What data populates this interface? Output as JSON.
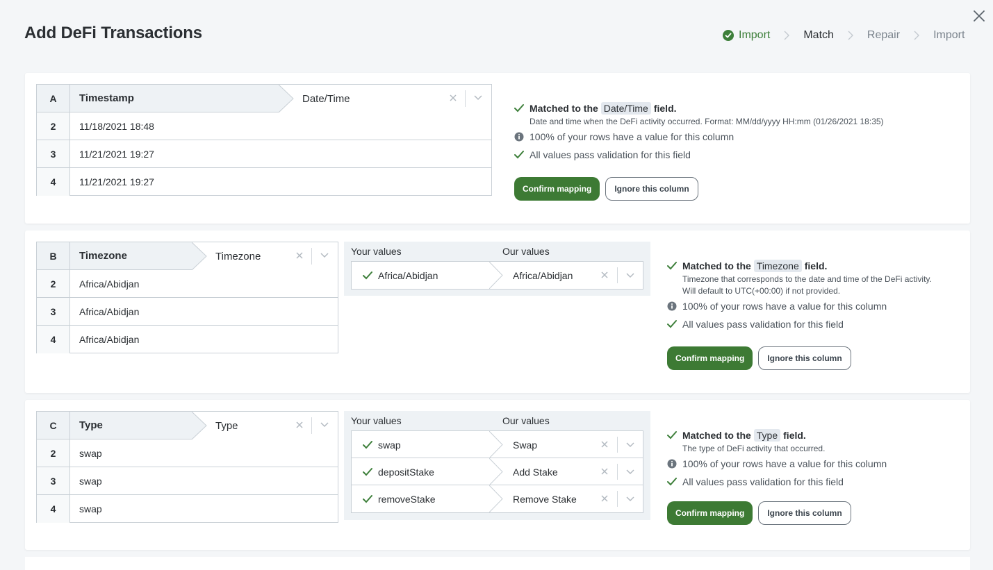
{
  "dialog": {
    "title": "Add DeFi Transactions"
  },
  "stepper": {
    "steps": [
      "Import",
      "Match",
      "Repair",
      "Import"
    ]
  },
  "labels": {
    "your_values": "Your values",
    "our_values": "Our values",
    "matched_prefix": "Matched to the",
    "matched_suffix": "field.",
    "confirm": "Confirm mapping",
    "ignore": "Ignore this column"
  },
  "columns": [
    {
      "letter": "A",
      "name": "Timestamp",
      "field": "Date/Time",
      "rows": [
        {
          "num": "2",
          "value": "11/18/2021 18:48"
        },
        {
          "num": "3",
          "value": "11/21/2021 19:27"
        },
        {
          "num": "4",
          "value": "11/21/2021 19:27"
        }
      ],
      "description": "Date and time when the DeFi activity occurred. Format: MM/dd/yyyy HH:mm (01/26/2021 18:35)",
      "coverage": "100% of your rows have a value for this column",
      "validation": "All values pass validation for this field"
    },
    {
      "letter": "B",
      "name": "Timezone",
      "field": "Timezone",
      "rows": [
        {
          "num": "2",
          "value": "Africa/Abidjan"
        },
        {
          "num": "3",
          "value": "Africa/Abidjan"
        },
        {
          "num": "4",
          "value": "Africa/Abidjan"
        }
      ],
      "value_map": [
        {
          "yours": "Africa/Abidjan",
          "ours": "Africa/Abidjan"
        }
      ],
      "description_1": "Timezone that corresponds to the date and time of the DeFi activity.",
      "description_2": "Will default to UTC(+00:00) if not provided.",
      "coverage": "100% of your rows have a value for this column",
      "validation": "All values pass validation for this field"
    },
    {
      "letter": "C",
      "name": "Type",
      "field": "Type",
      "rows": [
        {
          "num": "2",
          "value": "swap"
        },
        {
          "num": "3",
          "value": "swap"
        },
        {
          "num": "4",
          "value": "swap"
        }
      ],
      "value_map": [
        {
          "yours": "swap",
          "ours": "Swap"
        },
        {
          "yours": "depositStake",
          "ours": "Add Stake"
        },
        {
          "yours": "removeStake",
          "ours": "Remove Stake"
        }
      ],
      "description": "The type of DeFi activity that occurred.",
      "coverage": "100% of your rows have a value for this column",
      "validation": "All values pass validation for this field"
    }
  ],
  "colors": {
    "primary_green": "#3d7a34",
    "check_green": "#3d7f3a",
    "header_bg": "#eef2f5"
  }
}
